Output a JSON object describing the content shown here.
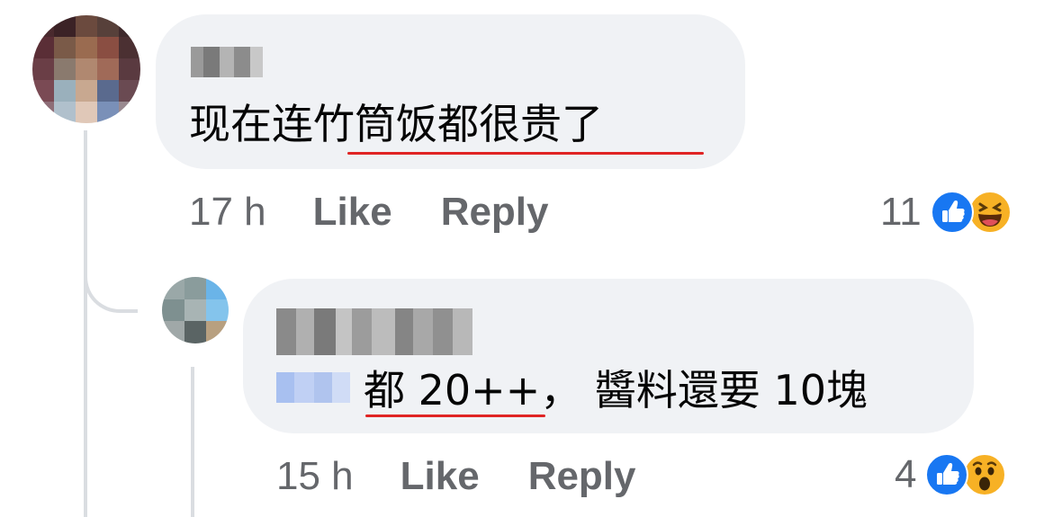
{
  "colors": {
    "bubble": "#f0f2f5",
    "meta_text": "#65676b",
    "body_text": "#050505",
    "underline": "#e02424",
    "like_blue": "#1877f2",
    "emoji_yellow": "#f7b125"
  },
  "comments": [
    {
      "text": "现在连竹筒饭都很贵了",
      "time": "17 h",
      "like_label": "Like",
      "reply_label": "Reply",
      "reaction_count": "11",
      "reactions": [
        "like-icon",
        "laugh-icon"
      ],
      "author_name_blurred": true
    },
    {
      "text": "都 20++， 醬料還要 10塊",
      "time": "15 h",
      "like_label": "Like",
      "reply_label": "Reply",
      "reaction_count": "4",
      "reactions": [
        "like-icon",
        "wow-icon"
      ],
      "author_name_blurred": true,
      "mention_blurred": true
    }
  ]
}
